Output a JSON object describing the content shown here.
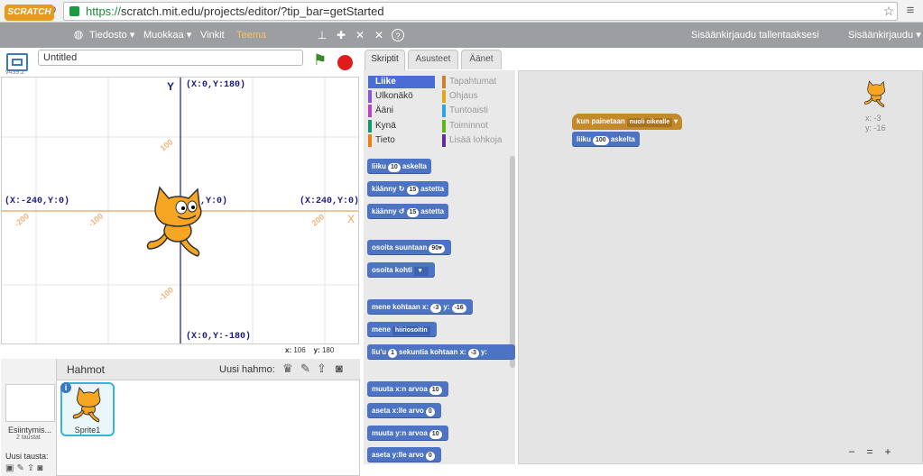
{
  "browser": {
    "back_icon": "arrow-left-icon",
    "url_https": "https://",
    "url_rest": "scratch.mit.edu/projects/editor/?tip_bar=getStarted"
  },
  "menu": {
    "logo": "SCRATCH",
    "file": "Tiedosto ▾",
    "edit": "Muokkaa ▾",
    "tips": "Vinkit",
    "theme": "Teema",
    "save_prompt": "Sisäänkirjaudu tallentaaksesi",
    "login": "Sisäänkirjaudu ▾"
  },
  "stage": {
    "title_value": "Untitled",
    "version": "v439.2",
    "top": "(X:0,Y:180)",
    "bottom": "(X:0,Y:-180)",
    "left": "(X:-240,Y:0)",
    "right": "(X:240,Y:0)",
    "center": ",Y:0)",
    "y_axis": "Y",
    "x_axis": "X",
    "ticks": [
      "100",
      "-100",
      "-100",
      "200",
      "-200"
    ],
    "mouse_x_label": "x:",
    "mouse_x": "106",
    "mouse_y_label": "y:",
    "mouse_y": "180"
  },
  "sprites": {
    "header": "Hahmot",
    "new_sprite": "Uusi hahmo:",
    "stage_label": "Esiintymis...",
    "backdrops": "2 taustat",
    "new_backdrop": "Uusi tausta:",
    "sprite1": "Sprite1",
    "info": "i"
  },
  "tabs": [
    "Skriptit",
    "Asusteet",
    "Äänet"
  ],
  "categories": [
    {
      "label": "Liike",
      "color": "#4a6cd4"
    },
    {
      "label": "Ulkonäkö",
      "color": "#8a55d7"
    },
    {
      "label": "Ääni",
      "color": "#bb42c3"
    },
    {
      "label": "Kynä",
      "color": "#0e9a6c"
    },
    {
      "label": "Tieto",
      "color": "#ee7d16"
    },
    {
      "label": "Tapahtumat",
      "color": "#c88330"
    },
    {
      "label": "Ohjaus",
      "color": "#e1a91a"
    },
    {
      "label": "Tuntoaisti",
      "color": "#2ca5e2"
    },
    {
      "label": "Toiminnot",
      "color": "#5cb712"
    },
    {
      "label": "Lisää lohkoja",
      "color": "#632d99"
    }
  ],
  "blocks": {
    "b1": "liiku",
    "b1v": "10",
    "b1s": "askelta",
    "b2": "käänny ↻",
    "b2v": "15",
    "b2s": "astetta",
    "b3": "käänny ↺",
    "b3v": "15",
    "b3s": "astetta",
    "b4": "osoita suuntaan",
    "b4v": "90▾",
    "b5": "osoita kohti",
    "b6": "mene kohtaan x:",
    "b6v": "-3",
    "b6y": "y:",
    "b6w": "-16",
    "b7": "mene",
    "b7v": "hiiriosoitin",
    "b8": "liu'u",
    "b8v": "1",
    "b8s": "sekuntia kohtaan x:",
    "b8w": "-3",
    "b8y": "y:",
    "b9": "muuta x:n arvoa",
    "b9v": "10",
    "b10": "aseta x:lle arvo",
    "b10v": "0",
    "b11": "muuta y:n arvoa",
    "b11v": "10",
    "b12": "aseta y:lle arvo",
    "b12v": "0"
  },
  "script": {
    "hat": "kun painetaan",
    "hat_key": "nuoli oikealle",
    "move": "liiku",
    "move_v": "100",
    "move_s": "askelta",
    "sprite_x": "x: -3",
    "sprite_y": "y: -16"
  },
  "zoom": {
    "out": "−",
    "reset": "=",
    "in": "+"
  }
}
